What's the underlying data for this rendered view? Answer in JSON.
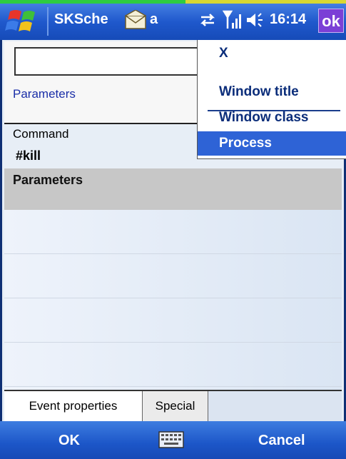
{
  "titlebar": {
    "app_title": "SKSche",
    "title_suffix": "a",
    "clock": "16:14",
    "ok_label": "ok"
  },
  "top_panel": {
    "name_value": "",
    "parameters_label": "Parameters"
  },
  "menu": {
    "items": [
      {
        "label": "X"
      },
      {
        "label": "Window title"
      },
      {
        "label": "Window class"
      },
      {
        "label": "Process"
      }
    ],
    "selected": "Process"
  },
  "command": {
    "label": "Command",
    "value": "#kill",
    "parameters_row": "Parameters"
  },
  "tabs": [
    {
      "label": "Event properties",
      "active": true
    },
    {
      "label": "Special",
      "active": false
    }
  ],
  "softkeys": {
    "left": "OK",
    "right": "Cancel",
    "center_icon": "keyboard-icon"
  },
  "icons": {
    "start": "windows-flag-icon",
    "notification": "envelope-icon",
    "connectivity": "sync-arrows-icon",
    "signal": "signal-strength-icon",
    "volume": "speaker-icon"
  },
  "colors": {
    "titlebar": "#1f58cc",
    "menu_selected": "#2e63d6",
    "ok_button": "#7b3fd6",
    "parameters_label": "#1b2fa8"
  }
}
